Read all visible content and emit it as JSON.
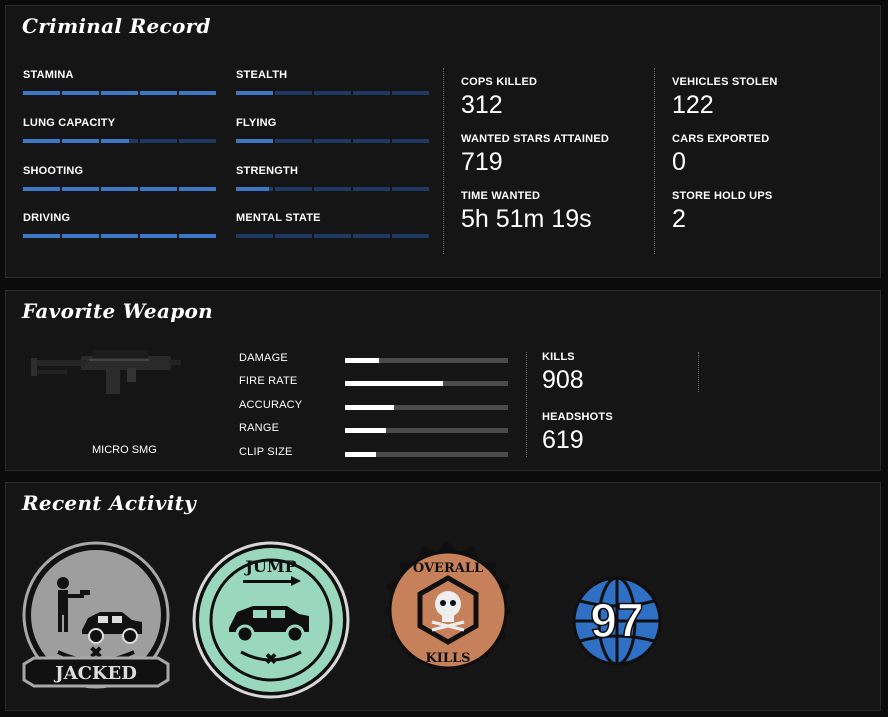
{
  "criminal_record": {
    "title": "Criminal Record",
    "skills": [
      {
        "label": "STAMINA",
        "level": 1.0
      },
      {
        "label": "STEALTH",
        "level": 0.2
      },
      {
        "label": "LUNG CAPACITY",
        "level": 0.55
      },
      {
        "label": "FLYING",
        "level": 0.2
      },
      {
        "label": "SHOOTING",
        "level": 1.0
      },
      {
        "label": "STRENGTH",
        "level": 0.18
      },
      {
        "label": "DRIVING",
        "level": 1.0
      },
      {
        "label": "MENTAL STATE",
        "level": 0.0
      }
    ],
    "stats_left": [
      {
        "label": "COPS KILLED",
        "value": "312"
      },
      {
        "label": "WANTED STARS ATTAINED",
        "value": "719"
      },
      {
        "label": "TIME WANTED",
        "value": "5h 51m 19s"
      }
    ],
    "stats_right": [
      {
        "label": "VEHICLES STOLEN",
        "value": "122"
      },
      {
        "label": "CARS EXPORTED",
        "value": "0"
      },
      {
        "label": "STORE HOLD UPS",
        "value": "2"
      }
    ]
  },
  "favorite_weapon": {
    "title": "Favorite Weapon",
    "name": "MICRO SMG",
    "icon": "micro-smg-icon",
    "stats": [
      {
        "label": "DAMAGE",
        "level": 0.21
      },
      {
        "label": "FIRE RATE",
        "level": 0.6
      },
      {
        "label": "ACCURACY",
        "level": 0.3
      },
      {
        "label": "RANGE",
        "level": 0.25
      },
      {
        "label": "CLIP SIZE",
        "level": 0.19
      }
    ],
    "kills_label": "KILLS",
    "kills": "908",
    "headshots_label": "HEADSHOTS",
    "headshots": "619"
  },
  "recent_activity": {
    "title": "Recent Activity",
    "badges": [
      {
        "name": "jacked-badge",
        "text": "JACKED",
        "color": "#9e9e9e"
      },
      {
        "name": "jump-badge",
        "text": "JUMP",
        "color": "#9ad8bd"
      },
      {
        "name": "overall-kills-badge",
        "text_top": "OVERALL",
        "text_bottom": "KILLS",
        "color": "#c6805a"
      },
      {
        "name": "globe-badge",
        "value": "97",
        "color": "#2f6fc4"
      }
    ]
  },
  "colors": {
    "skill_fill": "#3a78c7",
    "skill_empty": "#1e3a64",
    "panel_bg": "#151515"
  }
}
